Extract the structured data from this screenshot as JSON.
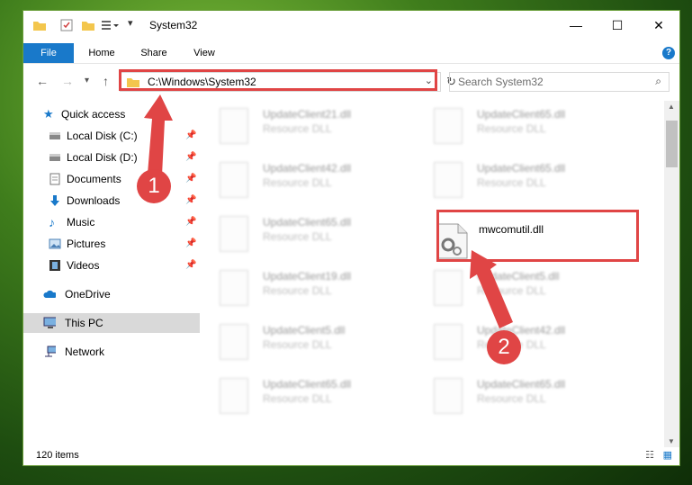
{
  "window": {
    "title": "System32"
  },
  "ribbon": {
    "tabs": [
      "File",
      "Home",
      "Share",
      "View"
    ],
    "help": "?"
  },
  "navigation": {
    "back_icon": "arrow-left-icon",
    "forward_icon": "arrow-right-icon",
    "recent_icon": "chevron-down-icon",
    "up_icon": "arrow-up-icon",
    "address": "C:\\Windows\\System32",
    "search_placeholder": "Search System32"
  },
  "sidebar": {
    "items": [
      {
        "label": "Quick access",
        "icon": "star-icon",
        "pinned": false
      },
      {
        "label": "Local Disk (C:)",
        "icon": "drive-icon",
        "pinned": true
      },
      {
        "label": "Local Disk (D:)",
        "icon": "drive-icon",
        "pinned": true
      },
      {
        "label": "Documents",
        "icon": "document-icon",
        "pinned": true
      },
      {
        "label": "Downloads",
        "icon": "download-icon",
        "pinned": true
      },
      {
        "label": "Music",
        "icon": "music-icon",
        "pinned": true
      },
      {
        "label": "Pictures",
        "icon": "picture-icon",
        "pinned": true
      },
      {
        "label": "Videos",
        "icon": "video-icon",
        "pinned": true
      },
      {
        "label": "OneDrive",
        "icon": "cloud-icon",
        "pinned": false
      },
      {
        "label": "This PC",
        "icon": "computer-icon",
        "pinned": false,
        "selected": true
      },
      {
        "label": "Network",
        "icon": "network-icon",
        "pinned": false
      }
    ]
  },
  "files": [
    {
      "name": "UpdateClient21.dll",
      "type": "Resource DLL",
      "col": 0,
      "row": 0
    },
    {
      "name": "UpdateClient65.dll",
      "type": "Resource DLL",
      "col": 1,
      "row": 0
    },
    {
      "name": "UpdateClient42.dll",
      "type": "Resource DLL",
      "col": 0,
      "row": 1
    },
    {
      "name": "UpdateClient65.dll",
      "type": "Resource DLL",
      "col": 1,
      "row": 1
    },
    {
      "name": "UpdateClient65.dll",
      "type": "Resource DLL",
      "col": 0,
      "row": 2
    },
    {
      "name": "mwcomutil.dll",
      "type": "",
      "col": 1,
      "row": 2,
      "highlighted": true
    },
    {
      "name": "UpdateClient19.dll",
      "type": "Resource DLL",
      "col": 0,
      "row": 3
    },
    {
      "name": "UpdateClient5.dll",
      "type": "Resource DLL",
      "col": 1,
      "row": 3
    },
    {
      "name": "UpdateClient5.dll",
      "type": "Resource DLL",
      "col": 0,
      "row": 4
    },
    {
      "name": "UpdateClient42.dll",
      "type": "Resource DLL",
      "col": 1,
      "row": 4
    },
    {
      "name": "UpdateClient65.dll",
      "type": "Resource DLL",
      "col": 0,
      "row": 5
    },
    {
      "name": "UpdateClient65.dll",
      "type": "Resource DLL",
      "col": 1,
      "row": 5
    }
  ],
  "status": {
    "item_count": "120 items"
  },
  "callouts": [
    "1",
    "2"
  ],
  "colors": {
    "accent": "#1979ca",
    "highlight": "#e04545"
  }
}
